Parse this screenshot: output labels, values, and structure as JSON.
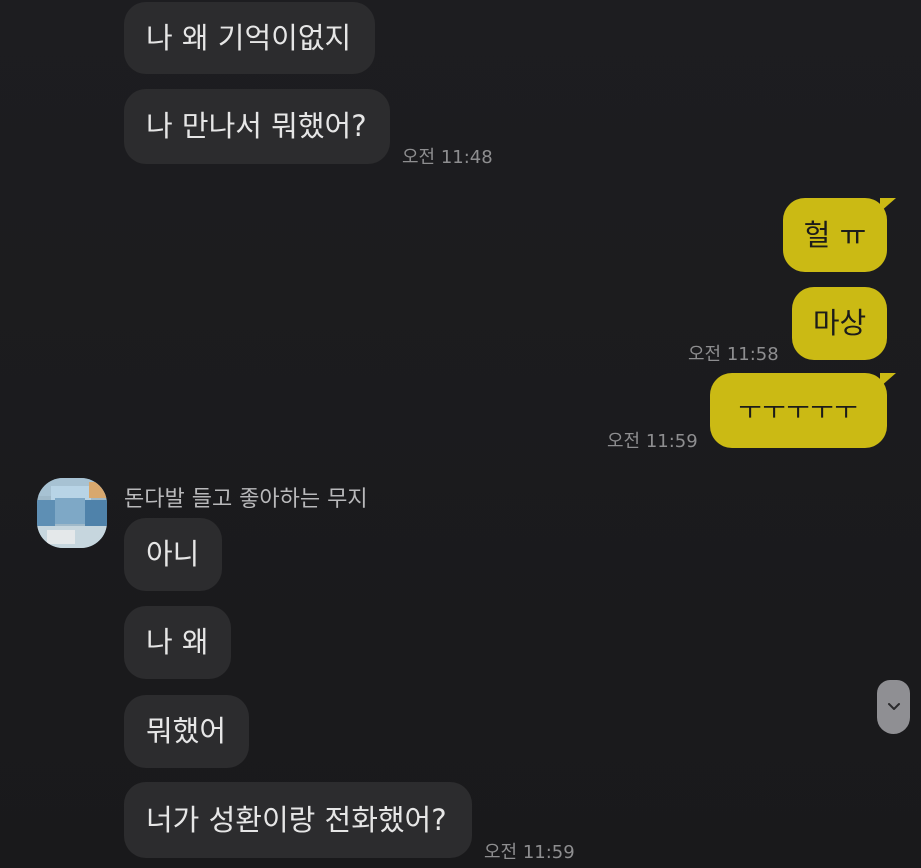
{
  "messages_before": [
    {
      "text": "나 왜 기억이없지"
    },
    {
      "text": "나 만나서 뭐했어?"
    }
  ],
  "time_1": "오전 11:48",
  "my_messages": [
    {
      "text": "헐 ㅠ"
    },
    {
      "text": "마상"
    },
    {
      "text": "ㅜㅜㅜㅜㅜ"
    }
  ],
  "time_2": "오전 11:58",
  "time_3": "오전 11:59",
  "sender_name": "돈다발 들고 좋아하는 무지",
  "messages_after": [
    {
      "text": "아니"
    },
    {
      "text": "나 왜"
    },
    {
      "text": "뭐했어"
    },
    {
      "text": "너가 성환이랑 전화했어?"
    }
  ],
  "time_4": "오전 11:59",
  "icons": {
    "scroll": "chevron-down-icon",
    "avatar": "avatar"
  },
  "colors": {
    "background": "#1b1b1d",
    "incoming_bubble": "#2c2c2e",
    "outgoing_bubble": "#cbba14"
  }
}
